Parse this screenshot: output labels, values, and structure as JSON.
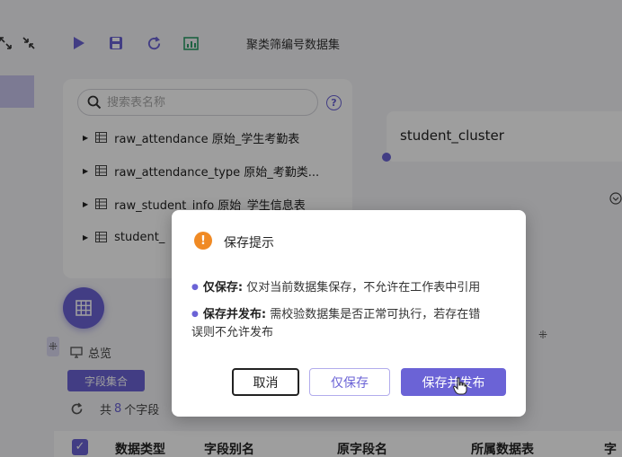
{
  "colors": {
    "accent": "#6b63d6",
    "warning": "#f08a24"
  },
  "toolbar": {
    "icons": [
      "expand-icon",
      "collapse-icon",
      "run-icon",
      "save-icon",
      "refresh-icon",
      "chart-icon"
    ],
    "title": "聚类筛编号数据集"
  },
  "tree": {
    "search_placeholder": "搜索表名称",
    "help_label": "?",
    "items": [
      {
        "label": "raw_attendance  原始_学生考勤表"
      },
      {
        "label": "raw_attendance_type  原始_考勤类..."
      },
      {
        "label": "raw_student_info  原始_学生信息表"
      },
      {
        "label": "student_"
      }
    ]
  },
  "canvas": {
    "node_title": "student_cluster"
  },
  "bottom": {
    "overview_label": "总览",
    "chip_label": "字段集合",
    "count_prefix": "共",
    "count_value": "8",
    "count_suffix": "个字段",
    "columns": [
      "数据类型",
      "字段别名",
      "原字段名",
      "所属数据表",
      "字"
    ]
  },
  "dialog": {
    "title": "保存提示",
    "line1_label": "仅保存:",
    "line1_text": "仅对当前数据集保存，不允许在工作表中引用",
    "line2_label": "保存并发布:",
    "line2_text": "需校验数据集是否正常可执行，若存在错",
    "line2_cont": "误则不允许发布",
    "buttons": {
      "cancel": "取消",
      "save_only": "仅保存",
      "save_publish": "保存并发布"
    }
  }
}
